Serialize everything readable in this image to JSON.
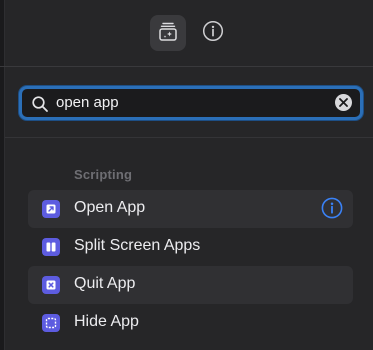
{
  "toolbar": {
    "library_icon": "shortcut-library-icon",
    "info_icon": "info-icon"
  },
  "search": {
    "value": "open app",
    "placeholder": "Search",
    "accent": "#2b6fb8"
  },
  "section": {
    "title": "Scripting"
  },
  "results": [
    {
      "label": "Open App",
      "icon": "open-app-icon",
      "highlighted": true,
      "info": true
    },
    {
      "label": "Split Screen Apps",
      "icon": "split-screen-icon",
      "highlighted": false,
      "info": false
    },
    {
      "label": "Quit App",
      "icon": "quit-app-icon",
      "highlighted": true,
      "info": false
    },
    {
      "label": "Hide App",
      "icon": "hide-app-icon",
      "highlighted": false,
      "info": false
    }
  ],
  "colors": {
    "icon_tile": "#5d5ce0",
    "info_accent": "#3a82f7"
  }
}
